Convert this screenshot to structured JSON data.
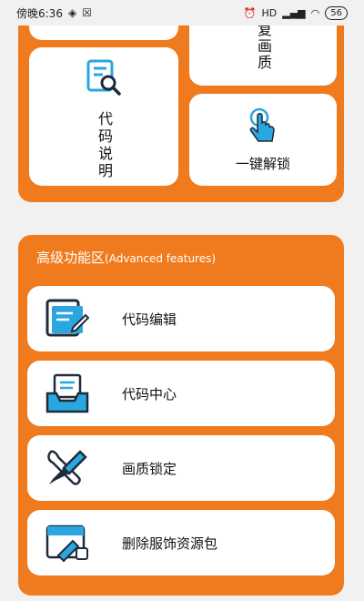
{
  "status": {
    "time": "傍晚6:36",
    "battery": "56",
    "signal": "HD"
  },
  "top_section": {
    "tile_top_right_text": "复画质",
    "code_description": "代码说明",
    "one_click_unlock": "一键解锁"
  },
  "advanced": {
    "title_cn": "高级功能区",
    "title_en": "(Advanced features)",
    "items": [
      {
        "label": "代码编辑",
        "icon": "edit-document-icon"
      },
      {
        "label": "代码中心",
        "icon": "inbox-tray-icon"
      },
      {
        "label": "画质锁定",
        "icon": "tools-icon"
      },
      {
        "label": "删除服饰资源包",
        "icon": "clean-image-icon"
      }
    ]
  },
  "colors": {
    "accent": "#f07b1e",
    "icon_blue": "#2aa6e0",
    "icon_dark": "#1d2b3a"
  }
}
